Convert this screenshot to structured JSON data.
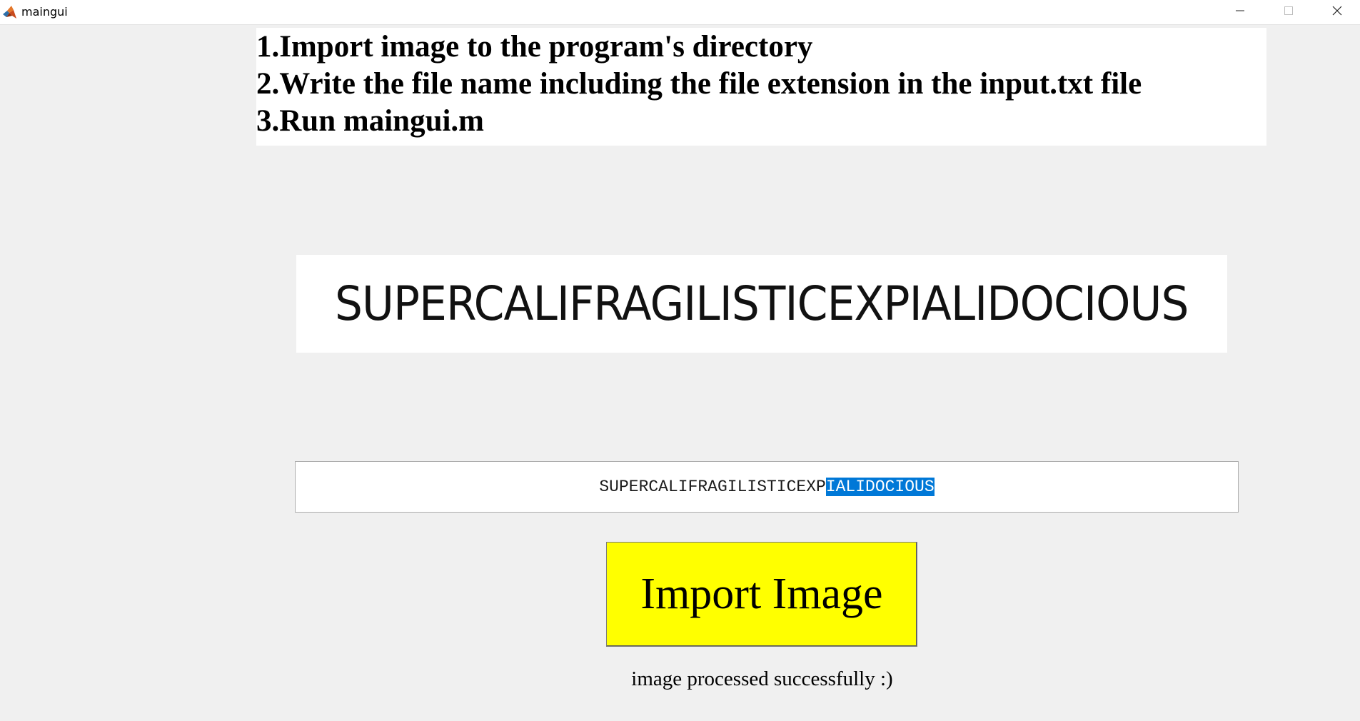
{
  "window": {
    "title": "maingui",
    "minimize_icon": "minimize-icon",
    "maximize_icon": "maximize-icon",
    "close_icon": "close-icon",
    "app_icon": "matlab-icon"
  },
  "instructions": {
    "line1": "1.Import image to the program's directory",
    "line2": "2.Write the file name including the file extension in the input.txt file",
    "line3": "3.Run maingui.m"
  },
  "image_panel": {
    "word": "SUPERCALIFRAGILISTICEXPIALIDOCIOUS"
  },
  "result": {
    "text_unselected": "SUPERCALIFRAGILISTICEXP",
    "text_selected": "IALIDOCIOUS"
  },
  "import_button": {
    "label": "Import Image",
    "color": "#ffff00"
  },
  "status": {
    "text": "image processed successfully :)"
  },
  "colors": {
    "background": "#f0f0f0",
    "selection": "#0078d7"
  }
}
